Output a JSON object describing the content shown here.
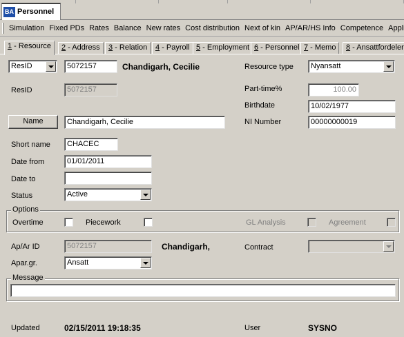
{
  "window": {
    "doc_tab_label": "Personnel",
    "doc_tab_badge": "BA"
  },
  "menu": [
    "Simulation",
    "Fixed PDs",
    "Rates",
    "Balance",
    "New rates",
    "Cost distribution",
    "Next of kin",
    "AP/AR/HS Info",
    "Competence",
    "Applica"
  ],
  "tabs": [
    {
      "key": "1",
      "label": " - Resource"
    },
    {
      "key": "2",
      "label": " - Address"
    },
    {
      "key": "3",
      "label": " - Relation"
    },
    {
      "key": "4",
      "label": " - Payroll"
    },
    {
      "key": "5",
      "label": " - Employment"
    },
    {
      "key": "6",
      "label": " - Personnel"
    },
    {
      "key": "7",
      "label": " - Memo"
    },
    {
      "key": "8",
      "label": " - Ansattfordeler"
    }
  ],
  "form": {
    "resid_selector": "ResID",
    "resid_value": "5072157",
    "resource_name_display": "Chandigarh, Cecilie",
    "resid_label": "ResID",
    "resid_readonly": "5072157",
    "name_button": "Name",
    "name_value": "Chandigarh, Cecilie",
    "short_name_label": "Short name",
    "short_name_value": "CHACEC",
    "date_from_label": "Date from",
    "date_from_value": "01/01/2011",
    "date_to_label": "Date to",
    "date_to_value": "",
    "status_label": "Status",
    "status_value": "Active",
    "resource_type_label": "Resource type",
    "resource_type_value": "Nyansatt",
    "parttime_label": "Part-time%",
    "parttime_value": "100.00",
    "birthdate_label": "Birthdate",
    "birthdate_value": "10/02/1977",
    "ni_label": "NI Number",
    "ni_value": "00000000019"
  },
  "options": {
    "legend": "Options",
    "overtime": "Overtime",
    "piecework": "Piecework",
    "gl_analysis": "GL Analysis",
    "agreement": "Agreement"
  },
  "apar": {
    "id_label": "Ap/Ar ID",
    "id_value": "5072157",
    "name_display": "Chandigarh,",
    "contract_label": "Contract",
    "contract_value": "",
    "group_label": "Apar.gr.",
    "group_value": "Ansatt"
  },
  "message": {
    "legend": "Message",
    "value": ""
  },
  "footer": {
    "updated_label": "Updated",
    "updated_value": "02/15/2011 19:18:35",
    "user_label": "User",
    "user_value": "SYSNO"
  }
}
